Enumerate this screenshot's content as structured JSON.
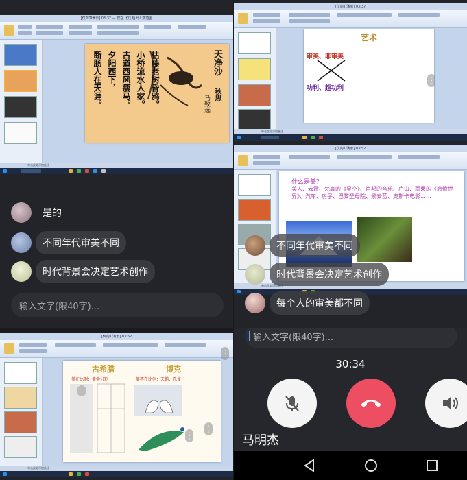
{
  "top_left": {
    "ppt_title": "[仅向TI演示] 03:37 — 仅在 [仅] 超出人数范围",
    "status_text": "单击此处添加备注",
    "poem": {
      "title": "天净沙",
      "season": "秋思",
      "author": "马致远",
      "lines": [
        "枯藤老树昏鸦。",
        "小桥流水人家。",
        "古道西风瘦马。",
        "夕阳西下，",
        "断肠人在天涯。"
      ]
    },
    "chat": [
      {
        "text": "是的"
      },
      {
        "text": "不同年代审美不同"
      },
      {
        "text": "时代背景会决定艺术创作"
      }
    ],
    "input_placeholder": "输入文字(限40字)..."
  },
  "top_right": {
    "ppt1_title": "[仅向TI演示] 03:37",
    "slide1": {
      "title": "艺术",
      "left_top": "审美、非审美",
      "left_bottom": "功利、超功利"
    },
    "ppt2_title": "[仅向TI演示] 03:52",
    "slide2": {
      "question": "什么是美？",
      "body": "美人、云霞、梵高的《星空》、肖邦的音乐、庐山、雨果的《悲惨世界》、汽车、房子、巴黎圣母院、景泰蓝、奥斯卡电影……"
    },
    "status_text": "单击此处添加备注",
    "chat": [
      {
        "text": "不同年代审美不同"
      },
      {
        "text": "时代背景会决定艺术创作"
      },
      {
        "text": "每个人的审美都不同"
      }
    ]
  },
  "bottom_left": {
    "ppt_title": "[仅向TI演示] 03:52",
    "slide": {
      "left_title": "古希腊",
      "right_title": "博克",
      "left_note": "美在比例：黄金分割",
      "right_note": "美不在比例：天鹅、孔雀"
    },
    "status_text": "单击此处添加备注"
  },
  "bottom_right": {
    "input_placeholder": "输入文字(限40字)...",
    "timer": "30:34",
    "caller_name": "马明杰",
    "colors": {
      "hangup": "#ee4e61",
      "ctrl_bg": "#f4f4f4"
    }
  }
}
